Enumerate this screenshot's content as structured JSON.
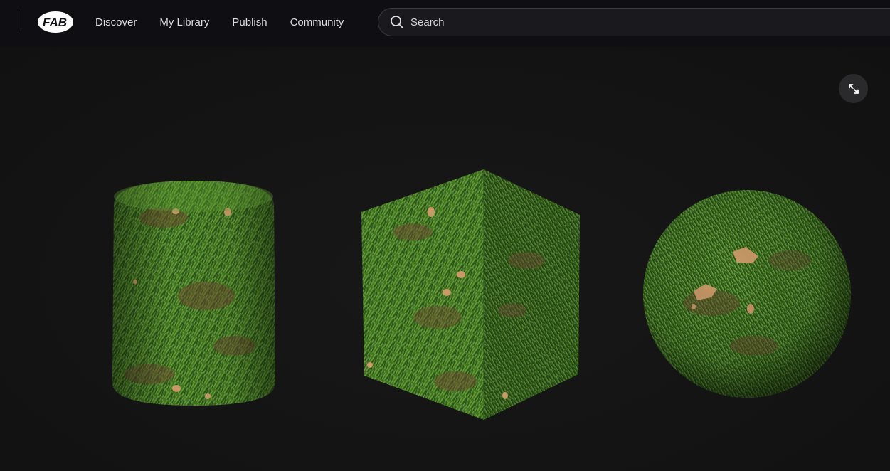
{
  "header": {
    "logo_text": "FAB",
    "nav": [
      {
        "label": "Discover"
      },
      {
        "label": "My Library"
      },
      {
        "label": "Publish"
      },
      {
        "label": "Community"
      }
    ],
    "search": {
      "placeholder": "Search",
      "icon": "search-icon"
    }
  },
  "viewer": {
    "expand_icon": "expand-icon",
    "previews": [
      "cylinder",
      "cube",
      "sphere"
    ],
    "material_colors": {
      "grass_dark": "#2d5a1e",
      "grass_mid": "#4f8a2c",
      "grass_light": "#7fb240",
      "dirt": "#7a4a32",
      "pebble": "#c99a68"
    }
  }
}
